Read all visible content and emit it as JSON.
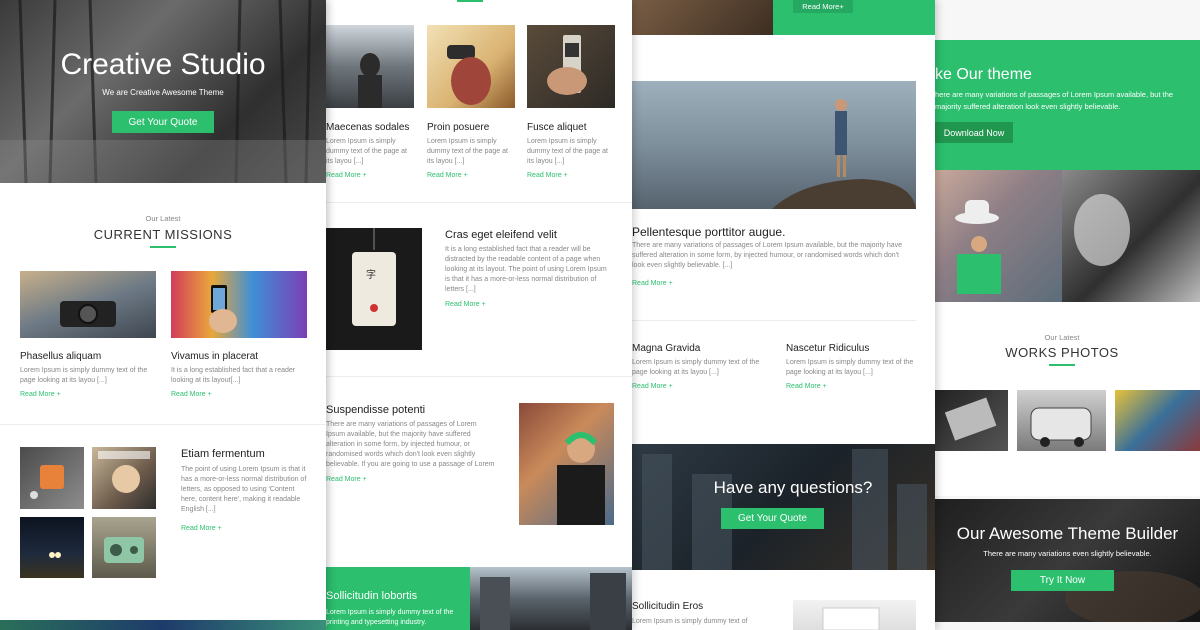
{
  "hero": {
    "title": "Creative Studio",
    "tagline": "We are Creative Awesome Theme",
    "cta": "Get Your Quote"
  },
  "missions": {
    "eyebrow": "Our Latest",
    "title": "CURRENT MISSIONS",
    "items": [
      {
        "title": "Phasellus aliquam",
        "text": "Lorem Ipsum is simply dummy text of the page looking at its layou [...]",
        "more": "Read More +"
      },
      {
        "title": "Vivamus in placerat",
        "text": "It is a long established fact that a reader looking at its layout[...]",
        "more": "Read More +"
      }
    ],
    "feature": {
      "title": "Etiam fermentum",
      "text": "The point of using Lorem Ipsum is that it has a more-or-less normal distribution of letters, as opposed to using 'Content here, content here', making it readable English [...]",
      "more": "Read More +"
    }
  },
  "col2": {
    "cards": [
      {
        "title": "Maecenas sodales",
        "text": "Lorem Ipsum is simply dummy text of the page at its layou [...]",
        "more": "Read More +"
      },
      {
        "title": "Proin posuere",
        "text": "Lorem Ipsum is simply dummy text of the page at its layou [...]",
        "more": "Read More +"
      },
      {
        "title": "Fusce aliquet",
        "text": "Lorem Ipsum is simply dummy text of the page at its layou [...]",
        "more": "Read More +"
      }
    ],
    "article1": {
      "title": "Cras eget eleifend velit",
      "text": "It is a long established fact that a reader will be distracted by the readable content of a page when looking at its layout. The point of using Lorem Ipsum is that it has a more-or-less normal distribution of letters [...]",
      "more": "Read More +"
    },
    "article2": {
      "title": "Suspendisse potenti",
      "text": "There are many variations of passages of Lorem Ipsum available, but the majority have suffered alteration in some form, by injected humour, or randomised words which don't look even slightly believable. If you are going to use a passage of Lorem Ipsum, you need to be sure there isn't anything embarrassing [...]",
      "more": "Read More +"
    },
    "banner": {
      "title": "Sollicitudin lobortis",
      "text": "Lorem Ipsum is simply dummy text of the printing and typesetting industry."
    }
  },
  "col3": {
    "top_more": "Read More+",
    "post": {
      "title": "Pellentesque porttitor augue.",
      "text": "There are many variations of passages of Lorem Ipsum available, but the majority have suffered alteration in some form, by injected humour, or randomised words which don't look even slightly believable. [...]",
      "more": "Read More +"
    },
    "mini": [
      {
        "title": "Magna Gravida",
        "text": "Lorem Ipsum is simply dummy text of the page looking at its layou [...]",
        "more": "Read More +"
      },
      {
        "title": "Nascetur Ridiculus",
        "text": "Lorem Ipsum is simply dummy text of the page looking at its layou [...]",
        "more": "Read More +"
      }
    ],
    "questions": {
      "title": "Have any questions?",
      "cta": "Get Your Quote"
    },
    "bottom": {
      "title": "Sollicitudin Eros",
      "text": "Lorem Ipsum is simply dummy text of"
    }
  },
  "col4": {
    "banner": {
      "title": "ke Our theme",
      "text": "here are many variations of passages of Lorem Ipsum available, but the majority suffered alteration look even slightly believable.",
      "cta": "Download Now"
    },
    "works": {
      "eyebrow": "Our Latest",
      "title": "WORKS PHOTOS"
    },
    "builder": {
      "title": "Our Awesome Theme Builder",
      "text": "There are many variations even slightly believable.",
      "cta": "Try It Now"
    }
  },
  "colors": {
    "accent": "#2bbf6e",
    "dark": "#2a2a2a"
  }
}
